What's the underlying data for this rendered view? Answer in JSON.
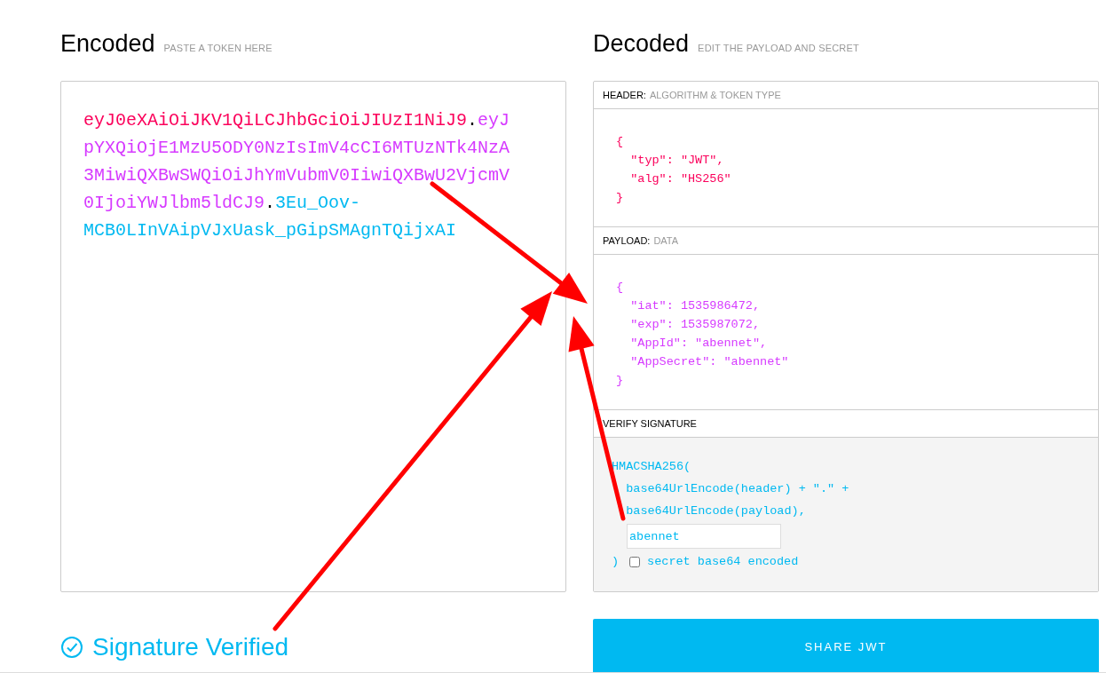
{
  "encoded": {
    "title": "Encoded",
    "hint": "PASTE A TOKEN HERE",
    "token": [
      {
        "kind": "header",
        "text": "eyJ0eXAiOiJKV1QiLCJhbGciOiJIUzI1NiJ9"
      },
      {
        "kind": "dot",
        "text": "."
      },
      {
        "kind": "payload",
        "text": "eyJpYXQiOjE1MzU5ODY0NzIsImV4cCI6MTUzNTk4NzA3MiwiQXBwSWQiOiJhYmVubmV0IiwiQXBwU2VjcmV0IjoiYWJlbm5ldCJ9"
      },
      {
        "kind": "dot",
        "text": "."
      },
      {
        "kind": "signature",
        "text": "3Eu_Oov-MCB0LInVAipVJxUask_pGipSMAgnTQijxAI"
      }
    ]
  },
  "decoded": {
    "title": "Decoded",
    "hint": "EDIT THE PAYLOAD AND SECRET",
    "sections": [
      {
        "kind": "header",
        "label": "HEADER:",
        "sublabel": "ALGORITHM & TOKEN TYPE",
        "lines": [
          "{",
          "  \"typ\": \"JWT\",",
          "  \"alg\": \"HS256\"",
          "}"
        ]
      },
      {
        "kind": "payload",
        "label": "PAYLOAD:",
        "sublabel": "DATA",
        "lines": [
          "{",
          "  \"iat\": 1535986472,",
          "  \"exp\": 1535987072,",
          "  \"AppId\": \"abennet\",",
          "  \"AppSecret\": \"abennet\"",
          "}"
        ]
      }
    ],
    "verify": {
      "label": "VERIFY SIGNATURE",
      "lines": [
        "HMACSHA256(",
        "  base64UrlEncode(header) + \".\" +",
        "  base64UrlEncode(payload),"
      ],
      "secret": "abennet",
      "close": ")",
      "base64_checked": false,
      "base64_label": "secret base64 encoded"
    }
  },
  "status": {
    "text": "Signature Verified"
  },
  "share_button": "SHARE JWT"
}
